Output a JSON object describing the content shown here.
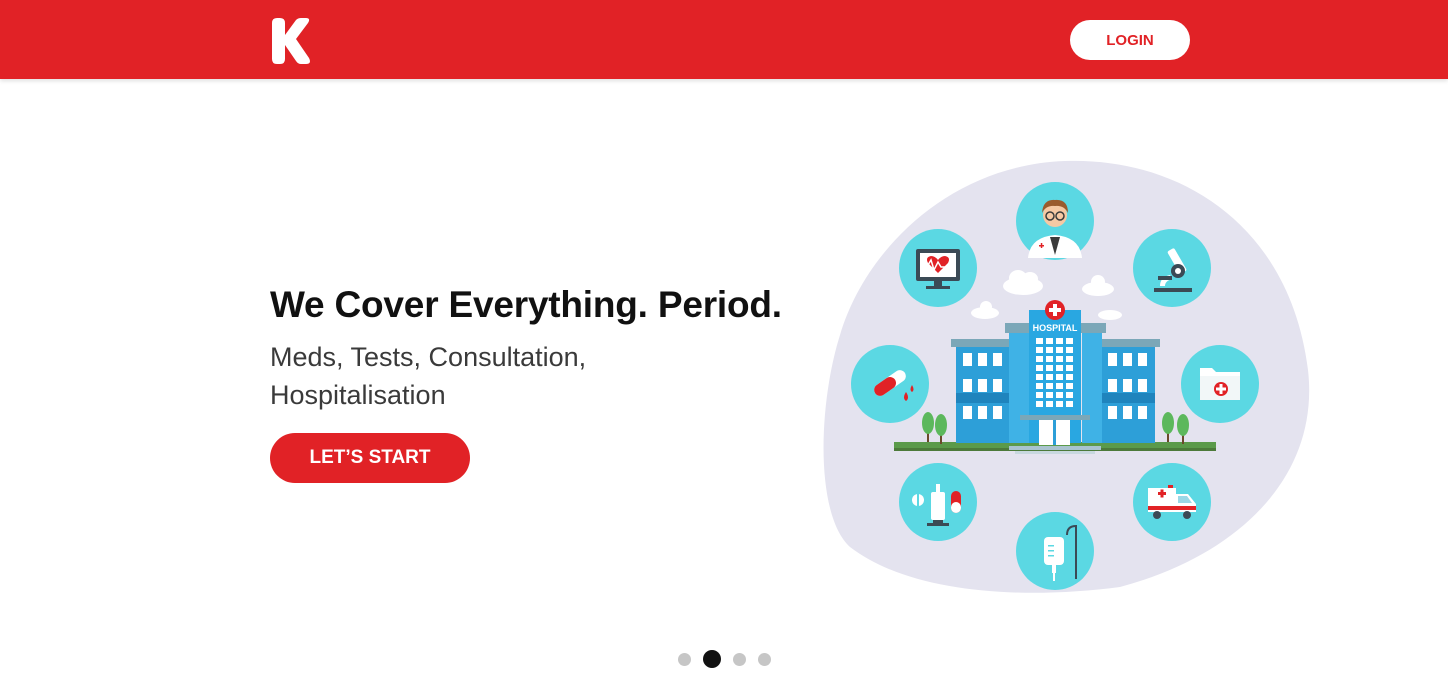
{
  "header": {
    "logo_letter": "K",
    "login_label": "LOGIN"
  },
  "hero": {
    "headline": "We Cover Everything. Period.",
    "subline": "Meds, Tests, Consultation, Hospitalisation",
    "cta_label": "LET’S START",
    "illustration": {
      "hospital_sign": "HOSPITAL",
      "icons": [
        "doctor-icon",
        "microscope-icon",
        "medical-folder-icon",
        "ambulance-icon",
        "iv-drip-icon",
        "syringe-pills-icon",
        "test-tube-icon",
        "heart-monitor-icon"
      ]
    }
  },
  "carousel": {
    "slides": 4,
    "active_index": 1
  },
  "colors": {
    "brand_red": "#e12226",
    "blob": "#e4e3ef",
    "icon_circle": "#5bd8e3",
    "building_blue": "#2d9fd8"
  }
}
